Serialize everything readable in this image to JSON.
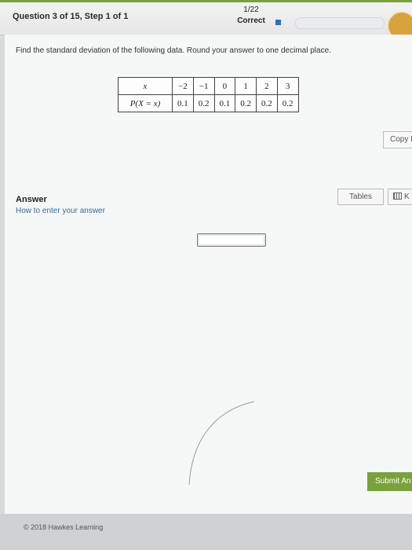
{
  "header": {
    "question_label": "Question 3 of 15, Step 1 of 1",
    "progress_count": "1/22",
    "progress_status": "Correct",
    "accent_color": "#7aa23a"
  },
  "question": {
    "instruction": "Find the standard deviation of the following data. Round your answer to one decimal place.",
    "table": {
      "header_x": "x",
      "header_p": "P(X = x)",
      "x_values": [
        "−2",
        "−1",
        "0",
        "1",
        "2",
        "3"
      ],
      "p_values": [
        "0.1",
        "0.2",
        "0.1",
        "0.2",
        "0.2",
        "0.2"
      ]
    }
  },
  "toolbar": {
    "copy_label": "Copy D",
    "tables_label": "Tables",
    "keypad_label": "K"
  },
  "answer": {
    "title": "Answer",
    "help_link": "How to enter your answer",
    "value": ""
  },
  "actions": {
    "submit_label": "Submit An"
  },
  "footer": {
    "copyright": "© 2018 Hawkes Learning"
  }
}
